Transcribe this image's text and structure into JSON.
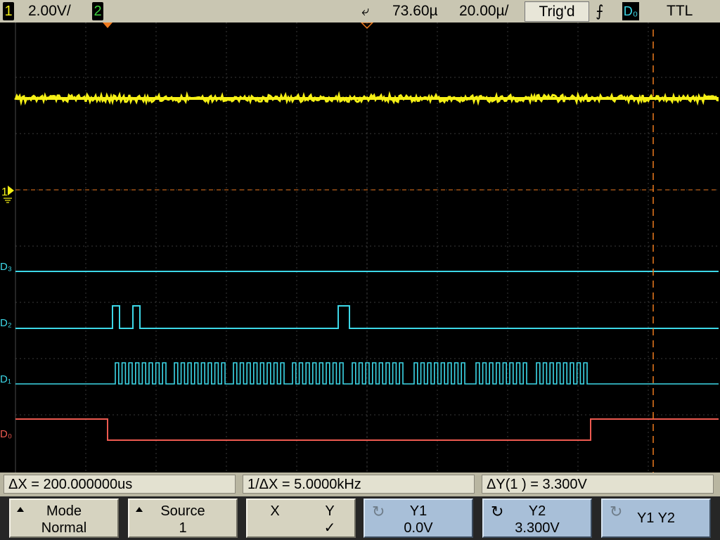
{
  "top": {
    "ch1_num": "1",
    "ch1_scale": "2.00V/",
    "ch2_num": "2",
    "delay": "73.60µ",
    "timebase": "20.00µ/",
    "status": "Trig'd",
    "trigger_source": "D₀",
    "logic": "TTL"
  },
  "marker_label": "1",
  "digital_labels": [
    "D₃",
    "D₂",
    "D₁",
    "D₀"
  ],
  "colors": {
    "ch1": "#f5f016",
    "digital": "#3dd8e8",
    "d0": "#ee5a50",
    "cursor": "#ee7a1e"
  },
  "readouts": {
    "dx": "ΔX = 200.000000us",
    "inv_dx": "1/ΔX = 5.0000kHz",
    "dy": "ΔY(1 ) = 3.300V"
  },
  "softkeys": [
    {
      "line1": "Mode",
      "line2": "Normal"
    },
    {
      "line1": "Source",
      "line2": "1"
    },
    {
      "line1": "X",
      "line1b": "Y",
      "line2": "✓"
    },
    {
      "line1": "Y1",
      "line2": "0.0V"
    },
    {
      "line1": "Y2",
      "line2": "3.300V"
    },
    {
      "line1": "Y1 Y2",
      "line2": ""
    }
  ]
}
